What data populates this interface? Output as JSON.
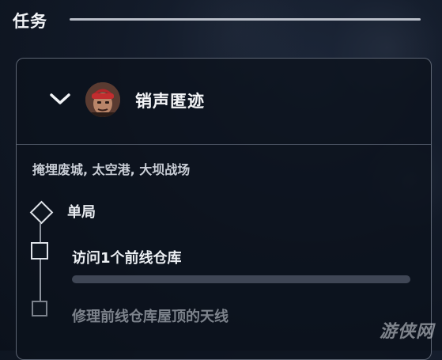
{
  "section": {
    "title": "任务"
  },
  "mission": {
    "name": "销声匿迹",
    "avatar_icon": "operator-portrait",
    "expand_icon": "chevron-down-icon",
    "locations": "掩埋废城, 太空港, 大坝战场",
    "step_type": "单局",
    "steps": [
      {
        "label": "访问1个前线仓库",
        "progress": 0
      },
      {
        "label": "修理前线仓库屋顶的天线"
      }
    ]
  },
  "watermark": "游侠网",
  "colors": {
    "background": "#121a28",
    "card_border": "#5c6472",
    "progress_track": "#3f4655",
    "progress_fill": "#8b93a3",
    "text_primary": "#eceff3",
    "text_muted": "#7d838c"
  }
}
